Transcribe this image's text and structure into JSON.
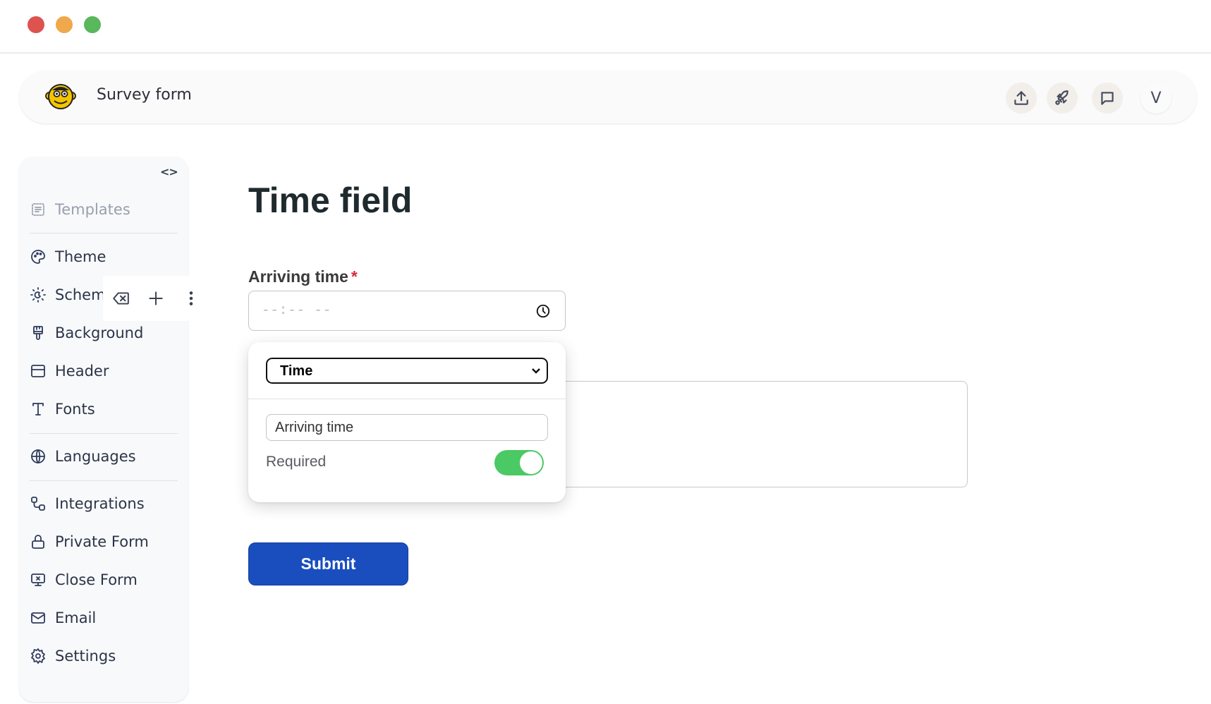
{
  "window": {
    "controls": [
      "close",
      "minimize",
      "maximize"
    ]
  },
  "header": {
    "logo": "monkey-logo",
    "title": "Survey form",
    "actions": [
      {
        "name": "share",
        "icon": "upload-icon"
      },
      {
        "name": "publish",
        "icon": "rocket-icon"
      },
      {
        "name": "feedback",
        "icon": "chat-icon"
      }
    ],
    "avatar_initial": "V"
  },
  "sidebar": {
    "collapse_icon": "<>",
    "items": [
      {
        "label": "Templates",
        "icon": "templates-icon",
        "muted": true
      },
      {
        "label": "Theme",
        "icon": "palette-icon"
      },
      {
        "label": "Scheme",
        "icon": "sun-moon-icon"
      },
      {
        "label": "Background",
        "icon": "paintbrush-icon"
      },
      {
        "label": "Header",
        "icon": "header-layout-icon"
      },
      {
        "label": "Fonts",
        "icon": "type-icon"
      },
      {
        "label": "Languages",
        "icon": "globe-icon"
      },
      {
        "label": "Integrations",
        "icon": "integrations-icon"
      },
      {
        "label": "Private Form",
        "icon": "lock-icon"
      },
      {
        "label": "Close Form",
        "icon": "monitor-x-icon"
      },
      {
        "label": "Email",
        "icon": "mail-icon"
      },
      {
        "label": "Settings",
        "icon": "gear-icon"
      }
    ]
  },
  "field_toolbar": {
    "actions": [
      "delete",
      "add",
      "more"
    ]
  },
  "form": {
    "title": "Time field",
    "field": {
      "label": "Arriving time",
      "required_marker": "*",
      "placeholder": "--:-- --"
    },
    "submit_label": "Submit"
  },
  "popover": {
    "type_select": "Time",
    "label_value": "Arriving time",
    "required_label": "Required",
    "required_on": true,
    "toggle_color": "#4bc964"
  },
  "colors": {
    "accent": "#1a4ebf",
    "required": "#d52a3a"
  }
}
